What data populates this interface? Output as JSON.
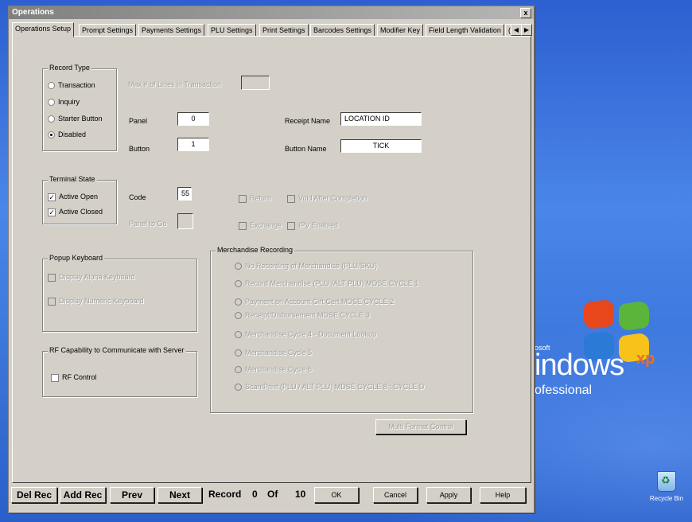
{
  "window": {
    "title": "Operations",
    "close_glyph": "x"
  },
  "tabs": [
    {
      "label": "Operations Setup"
    },
    {
      "label": "Prompt Settings"
    },
    {
      "label": "Payments Settings"
    },
    {
      "label": "PLU Settings"
    },
    {
      "label": "Print Settings"
    },
    {
      "label": "Barcodes Settings"
    },
    {
      "label": "Modifier Key"
    },
    {
      "label": "Field Length Validation"
    },
    {
      "label": "("
    }
  ],
  "record_type": {
    "title": "Record Type",
    "options": [
      {
        "label": "Transaction",
        "selected": false
      },
      {
        "label": "Inquiry",
        "selected": false
      },
      {
        "label": "Starter Button",
        "selected": false
      },
      {
        "label": "Disabled",
        "selected": true
      }
    ]
  },
  "fields": {
    "max_lines_label": "Max # of Lines in Transaction",
    "max_lines_value": "",
    "panel_label": "Panel",
    "panel_value": "0",
    "button_label": "Button",
    "button_value": "1",
    "receipt_name_label": "Receipt Name",
    "receipt_name_value": "LOCATION ID",
    "button_name_label": "Button Name",
    "button_name_value": "TICK",
    "code_label": "Code",
    "code_value": "55",
    "panel_to_go_label": "Panel to Go",
    "panel_to_go_value": ""
  },
  "terminal_state": {
    "title": "Terminal State",
    "options": [
      {
        "label": "Active Open",
        "checked": true
      },
      {
        "label": "Active Closed",
        "checked": true
      }
    ]
  },
  "misc_checks": [
    {
      "label": "Return",
      "checked": false
    },
    {
      "label": "Void After Completion",
      "checked": false
    },
    {
      "label": "Exchange",
      "checked": false
    },
    {
      "label": "IPV Enabled",
      "checked": false
    }
  ],
  "popup_keyboard": {
    "title": "Popup Keyboard",
    "options": [
      {
        "label": "Display Alpha Keyboard",
        "checked": false
      },
      {
        "label": "Display Numeric Keyboard",
        "checked": false
      }
    ]
  },
  "rf_capability": {
    "title": "RF Capability to Communicate with Server",
    "options": [
      {
        "label": "RF Control",
        "checked": false
      }
    ]
  },
  "merchandise": {
    "title": "Merchandise Recording",
    "options": [
      {
        "label": "No Recording of Merchandise (PLU/SKU)"
      },
      {
        "label": "Record Merchandise (PLU /ALT PLU) MDSE CYCLE 1"
      },
      {
        "label": "Payment on Account Gift Cert MDSE CYCLE 2"
      },
      {
        "label": "Receipt/Disbursement MDSE CYCLE 3"
      },
      {
        "label": "Merchandise Cycle 4 - Document Lookup"
      },
      {
        "label": "Merchandise Cycle 5"
      },
      {
        "label": "Merchandise Cycle 6"
      },
      {
        "label": "Scan/Print (PLU / ALT PLU) MDSE CYCLE 8 : CYCLE D"
      }
    ],
    "multi_format_button": "Multi Format Control"
  },
  "bottom_bar": {
    "del_rec": "Del Rec",
    "add_rec": "Add Rec",
    "prev": "Prev",
    "next": "Next",
    "record_label": "Record",
    "record_value": "0",
    "of_label": "Of",
    "of_value": "10",
    "ok": "OK",
    "cancel": "Cancel",
    "apply": "Apply",
    "help": "Help"
  },
  "desktop": {
    "ms_text": "osoft",
    "windows_text": "indows",
    "xp_text": "xp",
    "professional_text": "ofessional",
    "recycle_bin_label": "Recycle Bin"
  }
}
